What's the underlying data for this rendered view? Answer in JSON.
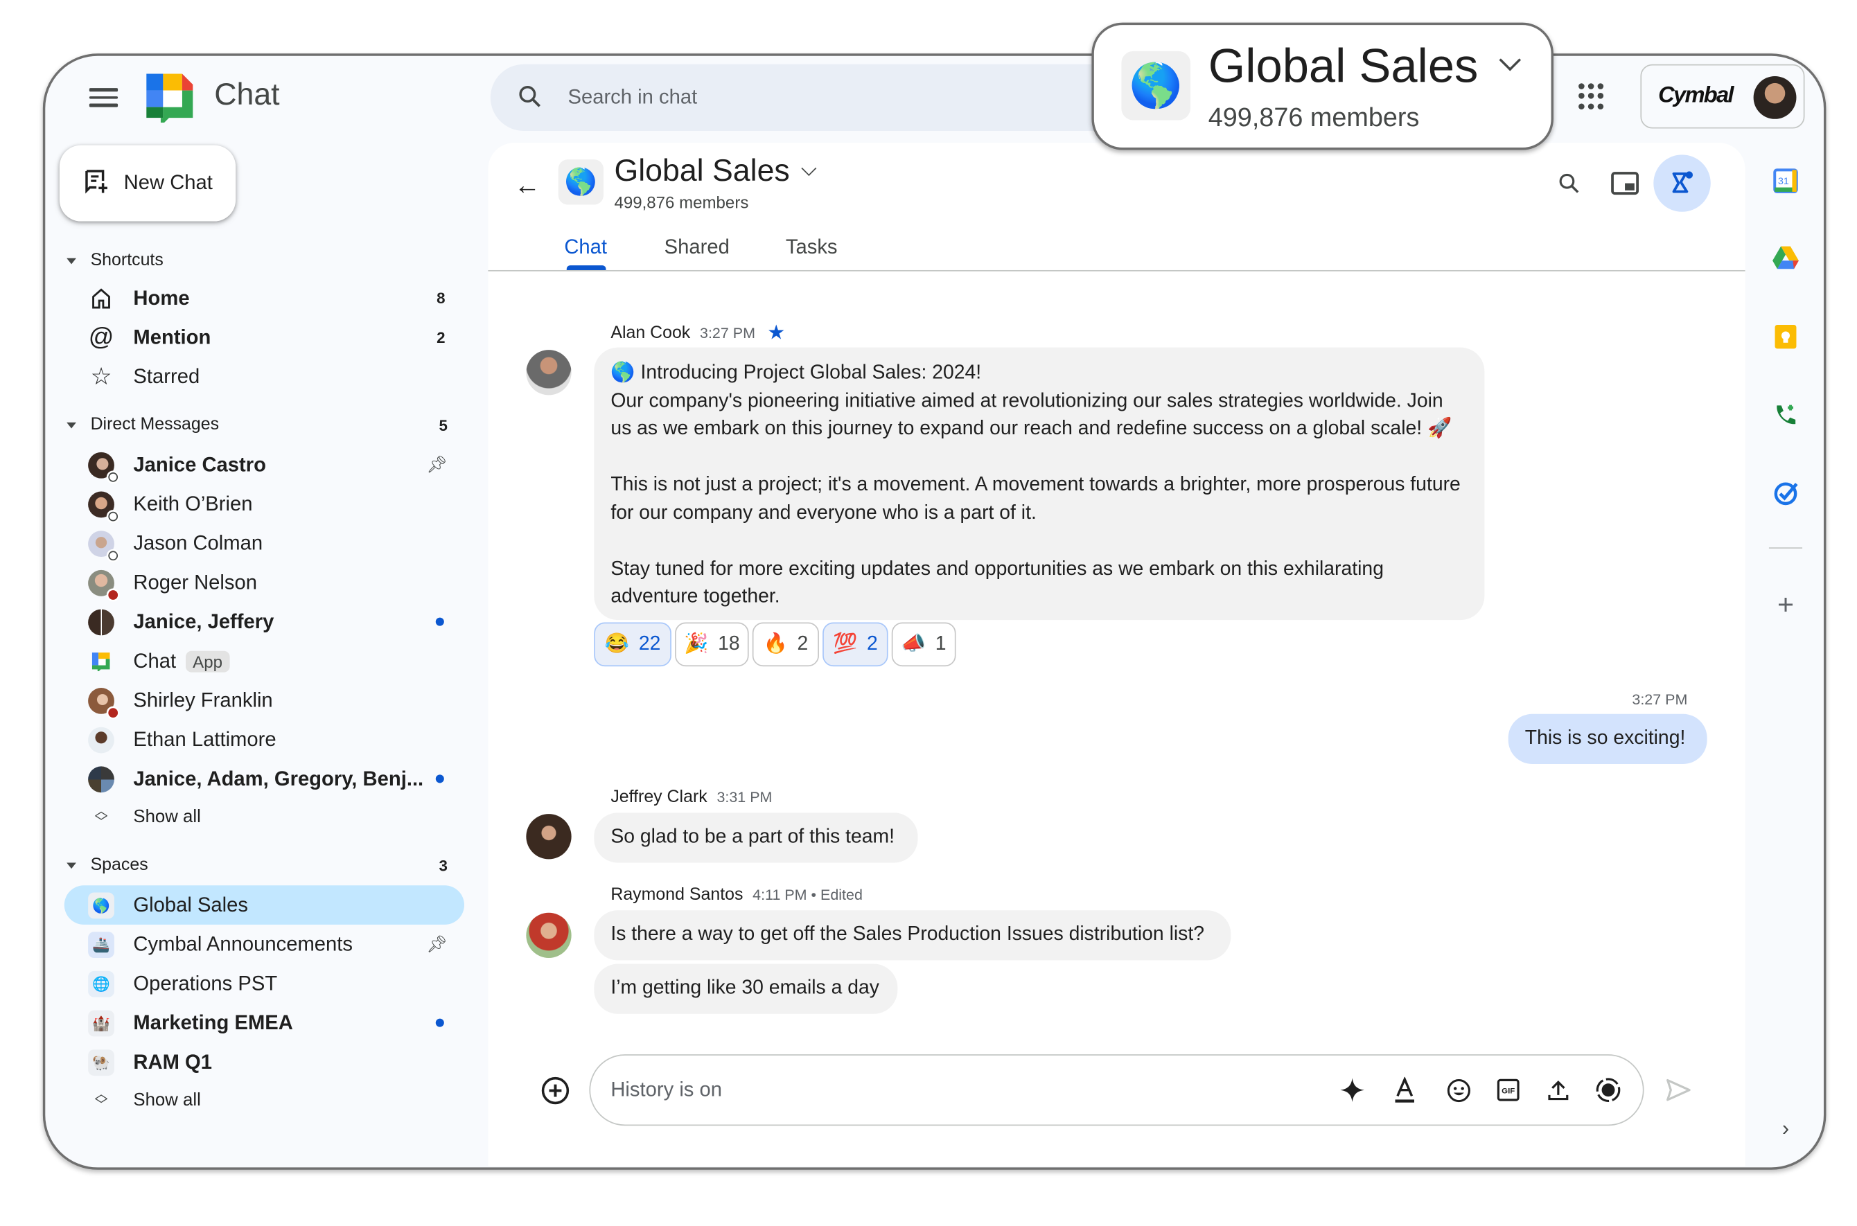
{
  "app": {
    "title": "Chat"
  },
  "search": {
    "placeholder": "Search in chat"
  },
  "account": {
    "org": "Cymbal"
  },
  "sidebar": {
    "new_chat_label": "New Chat",
    "shortcuts": {
      "title": "Shortcuts",
      "items": [
        {
          "label": "Home",
          "badge": "8",
          "icon": "home-icon",
          "bold": true
        },
        {
          "label": "Mention",
          "badge": "2",
          "icon": "at-sign-icon",
          "bold": true
        },
        {
          "label": "Starred",
          "badge": "",
          "icon": "star-outline-icon",
          "bold": false
        }
      ]
    },
    "direct_messages": {
      "title": "Direct Messages",
      "count": "5",
      "items": [
        {
          "label": "Janice Castro",
          "bold": true,
          "pinned": true,
          "status": "away"
        },
        {
          "label": "Keith O’Brien",
          "bold": false,
          "status": "away"
        },
        {
          "label": "Jason Colman",
          "bold": false,
          "status": "away"
        },
        {
          "label": "Roger Nelson",
          "bold": false,
          "status": "dnd"
        },
        {
          "label": "Janice, Jeffery",
          "bold": true,
          "unread": true
        },
        {
          "label": "Chat",
          "chip": "App",
          "bold": false
        },
        {
          "label": "Shirley Franklin",
          "bold": false,
          "status": "dnd"
        },
        {
          "label": "Ethan Lattimore",
          "bold": false
        },
        {
          "label": "Janice, Adam, Gregory, Benj...",
          "bold": true,
          "unread": true
        }
      ],
      "show_all": "Show all"
    },
    "spaces": {
      "title": "Spaces",
      "count": "3",
      "items": [
        {
          "label": "Global Sales",
          "emoji": "🌎",
          "active": true
        },
        {
          "label": "Cymbal Announcements",
          "emoji": "🚢",
          "pinned": true
        },
        {
          "label": "Operations PST",
          "emoji": "🌐"
        },
        {
          "label": "Marketing EMEA",
          "emoji": "🏰",
          "bold": true,
          "unread": true
        },
        {
          "label": "RAM Q1",
          "emoji": "🐏",
          "bold": true
        }
      ],
      "show_all": "Show all"
    }
  },
  "space": {
    "emoji": "🌎",
    "title": "Global Sales",
    "members": "499,876 members",
    "tabs": [
      "Chat",
      "Shared",
      "Tasks"
    ],
    "active_tab": "Chat"
  },
  "messages": [
    {
      "sender": "Alan Cook",
      "time": "3:27 PM",
      "starred": true,
      "lines": [
        "🌎 Introducing Project Global Sales: 2024!",
        "Our company's pioneering initiative aimed at revolutionizing our sales strategies worldwide. Join us as we embark on this journey to expand our reach and redefine success on a global scale! 🚀",
        "This is not just a project; it's a movement. A movement towards a brighter, more prosperous future for our company and everyone who is a part of it.",
        "Stay tuned for more exciting updates and opportunities as we embark on this exhilarating adventure together."
      ],
      "reactions": [
        {
          "emoji": "😂",
          "count": "22",
          "mine": true
        },
        {
          "emoji": "🎉",
          "count": "18",
          "mine": false
        },
        {
          "emoji": "🔥",
          "count": "2",
          "mine": false
        },
        {
          "emoji": "💯",
          "count": "2",
          "mine": true
        },
        {
          "emoji": "📣",
          "count": "1",
          "mine": false
        }
      ]
    },
    {
      "sender": "me",
      "time": "3:27 PM",
      "text": "This is so exciting!"
    },
    {
      "sender": "Jeffrey Clark",
      "time": "3:31 PM",
      "text": "So glad to be a part of this team!"
    },
    {
      "sender": "Raymond Santos",
      "time": "4:11 PM • Edited",
      "texts": [
        "Is there a way to get off the Sales Production Issues distribution list?",
        "I’m getting like 30 emails a day"
      ]
    }
  ],
  "compose": {
    "placeholder": "History is on"
  },
  "popup": {
    "emoji": "🌎",
    "title": "Global Sales",
    "members": "499,876 members"
  },
  "colors": {
    "accent": "#0b57d0",
    "active_nav": "#c2e7ff",
    "my_bubble": "#d3e3fd",
    "bubble": "#f2f2f2"
  }
}
